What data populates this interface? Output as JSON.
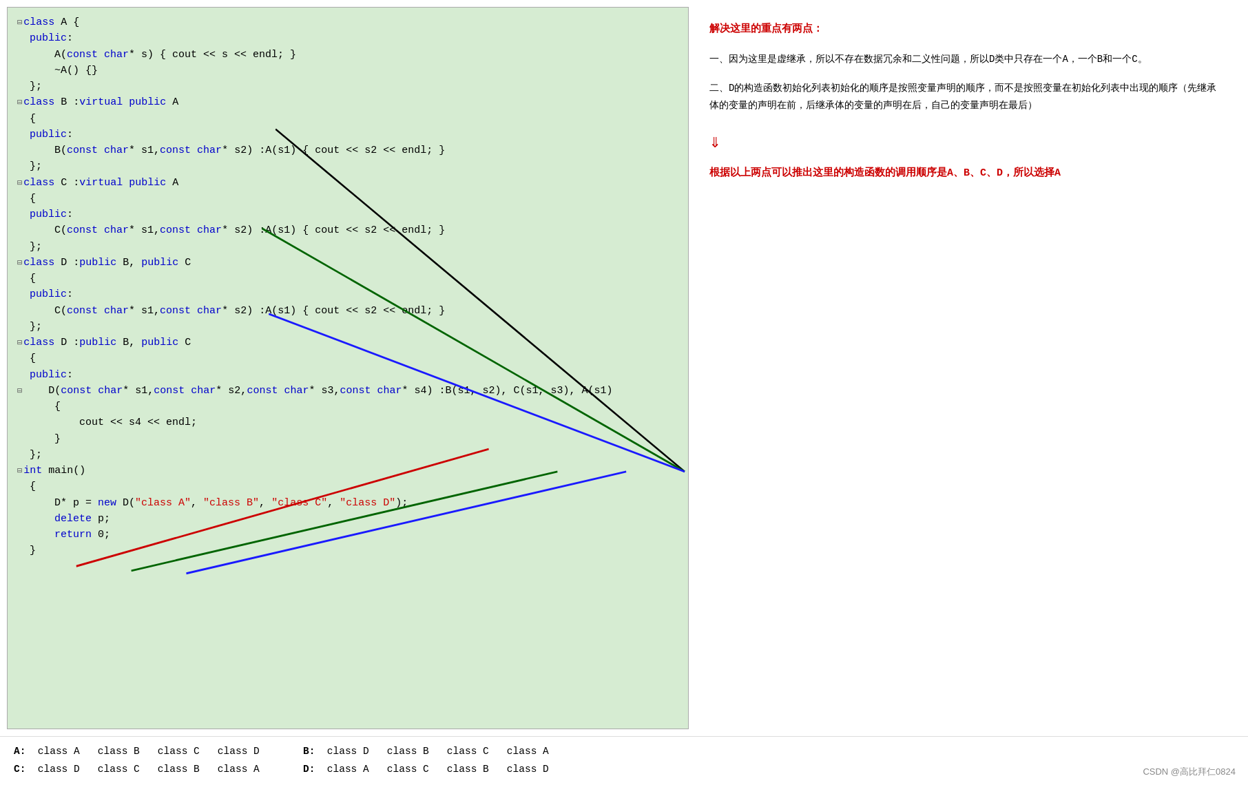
{
  "code": {
    "lines": [
      {
        "id": "l1",
        "content": "⊟class A {"
      },
      {
        "id": "l2",
        "content": "  public:"
      },
      {
        "id": "l3",
        "content": "      A(const char* s) { cout << s << endl; }"
      },
      {
        "id": "l4",
        "content": "      ~A() {}"
      },
      {
        "id": "l5",
        "content": "  };"
      },
      {
        "id": "l6",
        "content": "⊟class B :virtual public A"
      },
      {
        "id": "l7",
        "content": "  {"
      },
      {
        "id": "l8",
        "content": "  public:"
      },
      {
        "id": "l9",
        "content": "      B(const char* s1,const char* s2) :A(s1) { cout << s2 << endl; }"
      },
      {
        "id": "l10",
        "content": "  };"
      },
      {
        "id": "l11",
        "content": "⊟class C :virtual public A"
      },
      {
        "id": "l12",
        "content": "  {"
      },
      {
        "id": "l13",
        "content": "  public:"
      },
      {
        "id": "l14",
        "content": "      C(const char* s1,const char* s2) :A(s1) { cout << s2 << endl; }"
      },
      {
        "id": "l15",
        "content": "  };"
      },
      {
        "id": "l16",
        "content": "⊟class D :public B, public C"
      },
      {
        "id": "l17",
        "content": "  {"
      },
      {
        "id": "l18",
        "content": "  public:"
      },
      {
        "id": "l19",
        "content": "      C(const char* s1,const char* s2) :A(s1) { cout << s2 << endl; }"
      },
      {
        "id": "l20",
        "content": "  };"
      },
      {
        "id": "l21",
        "content": "⊟class D :public B, public C"
      },
      {
        "id": "l22",
        "content": "  {"
      },
      {
        "id": "l23",
        "content": "  public:"
      },
      {
        "id": "l24",
        "content": "⊟     D(const char* s1,const char* s2,const char* s3,const char* s4) :B(s1, s2), C(s1, s3), A(s1)"
      },
      {
        "id": "l25",
        "content": "      {"
      },
      {
        "id": "l26",
        "content": "          cout << s4 << endl;"
      },
      {
        "id": "l27",
        "content": "      }"
      },
      {
        "id": "l28",
        "content": "  };"
      },
      {
        "id": "l29",
        "content": "⊟int main()"
      },
      {
        "id": "l30",
        "content": "  {"
      },
      {
        "id": "l31",
        "content": "      D* p = new D(\"class A\", \"class B\", \"class C\", \"class D\");"
      },
      {
        "id": "l32",
        "content": "      delete p;"
      },
      {
        "id": "l33",
        "content": "      return 0;"
      },
      {
        "id": "l34",
        "content": "  }"
      }
    ]
  },
  "right": {
    "title": "解决这里的重点有两点：",
    "point1_title": "一、因为这里是虚继承，所以不存在数据冗余和二义性问题，所以D类中只存在一个A，一个B和一个C。",
    "point2_title": "二、D的构造函数初始化列表初始化的顺序是按照变量声明的顺序，而不是按照变量在初始化列表中出现的顺序（先继承体的变量的声明在前，后继承体的变量的声明在后，自己的变量声明在最后）",
    "conclusion": "根据以上两点可以推出这里的构造函数的调用顺序是A、B、C、D，所以选择A"
  },
  "options": [
    {
      "label": "A:",
      "text": "class A  class B  class C  class D"
    },
    {
      "label": "B:",
      "text": "class D  class B  class C  class A"
    },
    {
      "label": "C:",
      "text": "class D  class C  class B  class A"
    },
    {
      "label": "D:",
      "text": "class A  class C  class B  class D"
    }
  ],
  "watermark": "CSDN @高比拜仁0824"
}
